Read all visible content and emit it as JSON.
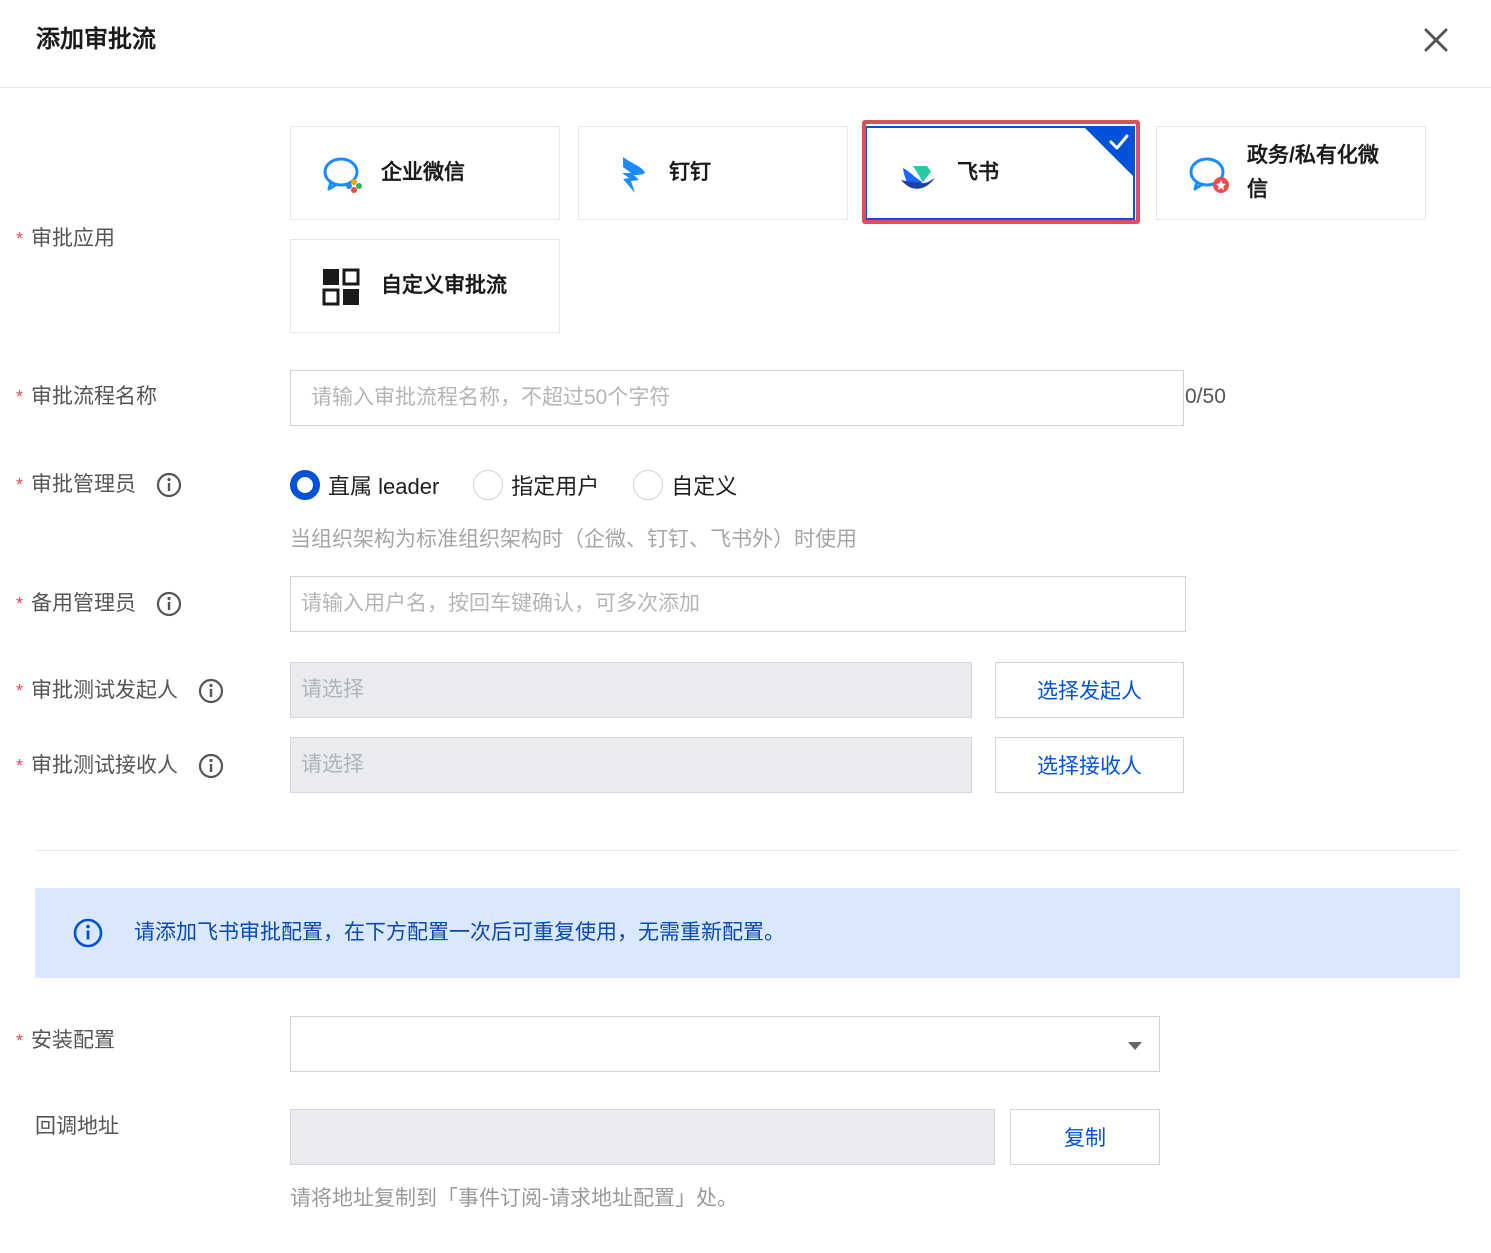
{
  "dialog": {
    "title": "添加审批流",
    "close_icon": "close-icon"
  },
  "form": {
    "approval_app": {
      "label": "审批应用",
      "options": [
        {
          "name": "企业微信",
          "icon": "wecom-icon",
          "selected": false
        },
        {
          "name": "钉钉",
          "icon": "dingtalk-icon",
          "selected": false
        },
        {
          "name": "飞书",
          "icon": "feishu-icon",
          "selected": true
        },
        {
          "name": "政务/私有化微",
          "name_line2": "信",
          "icon": "gov-wechat-icon",
          "selected": false
        },
        {
          "name": "自定义审批流",
          "icon": "custom-flow-icon",
          "selected": false
        }
      ]
    },
    "flow_name": {
      "label": "审批流程名称",
      "placeholder": "请输入审批流程名称，不超过50个字符",
      "value": "",
      "counter": "0/50"
    },
    "admin": {
      "label": "审批管理员",
      "options": [
        "直属 leader",
        "指定用户",
        "自定义"
      ],
      "selected": "直属 leader",
      "hint": "当组织架构为标准组织架构时（企微、钉钉、飞书外）时使用"
    },
    "backup_admin": {
      "label": "备用管理员",
      "placeholder": "请输入用户名，按回车键确认，可多次添加"
    },
    "test_initiator": {
      "label": "审批测试发起人",
      "placeholder": "请选择",
      "button": "选择发起人"
    },
    "test_receiver": {
      "label": "审批测试接收人",
      "placeholder": "请选择",
      "button": "选择接收人"
    },
    "notice": {
      "text": "请添加飞书审批配置，在下方配置一次后可重复使用，无需重新配置。"
    },
    "install_config": {
      "label": "安装配置",
      "value": ""
    },
    "callback": {
      "label": "回调地址",
      "value": "",
      "button": "复制",
      "hint": "请将地址复制到「事件订阅-请求地址配置」处。"
    }
  },
  "colors": {
    "primary": "#0052d9",
    "required": "#e34d59",
    "notice_bg": "#d9e8fd",
    "highlight": "#e34d59"
  }
}
